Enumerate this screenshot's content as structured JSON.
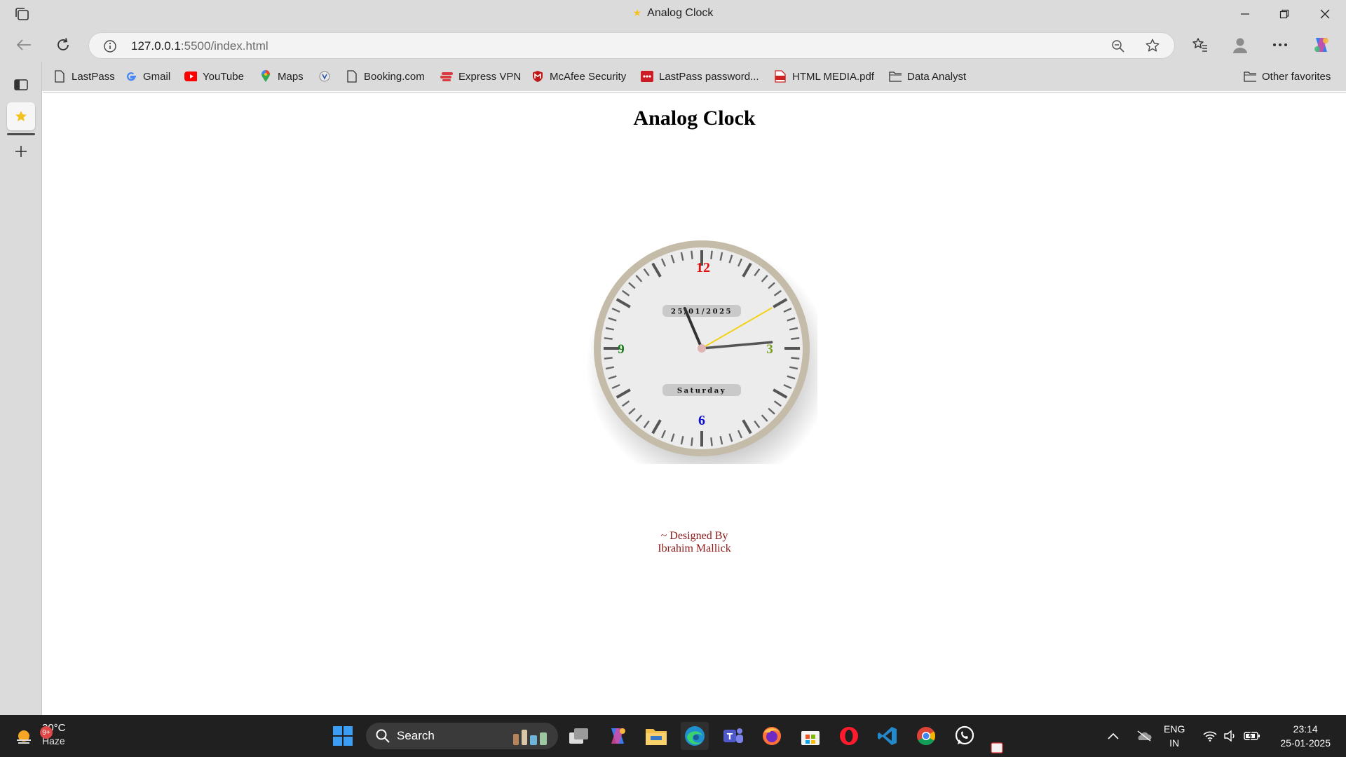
{
  "window": {
    "title": "Analog Clock"
  },
  "address_bar": {
    "url_host": "127.0.0.1",
    "url_path": ":5500/index.html"
  },
  "favorites": {
    "items": [
      {
        "label": "LastPass",
        "icon": "page-icon"
      },
      {
        "label": "Gmail",
        "icon": "google-icon"
      },
      {
        "label": "YouTube",
        "icon": "youtube-icon"
      },
      {
        "label": "Maps",
        "icon": "maps-pin-icon"
      },
      {
        "label": "",
        "icon": "extension-icon"
      },
      {
        "label": "Booking.com",
        "icon": "page-icon"
      },
      {
        "label": "Express VPN",
        "icon": "expressvpn-icon"
      },
      {
        "label": "McAfee Security",
        "icon": "mcafee-icon"
      },
      {
        "label": "LastPass password...",
        "icon": "lastpass-icon"
      },
      {
        "label": "HTML MEDIA.pdf",
        "icon": "pdf-icon"
      },
      {
        "label": "Data Analyst",
        "icon": "folder-icon"
      }
    ],
    "other": "Other favorites"
  },
  "page": {
    "heading": "Analog Clock",
    "credit_line1": "~ Designed By",
    "credit_line2": "Ibrahim Mallick"
  },
  "clock": {
    "date": "25/01/2025",
    "day": "Saturday",
    "numerals": {
      "twelve": "12",
      "three": "3",
      "six": "6",
      "nine": "9"
    },
    "colors": {
      "twelve": "#e01010",
      "three": "#7aa020",
      "six": "#1010d0",
      "nine": "#1a7a1a",
      "bezel": "#c4bba8",
      "face": "#ececec",
      "second_hand": "#f2d21a",
      "hand": "#555555"
    },
    "time": {
      "hour": 23,
      "minute": 14,
      "second": 10
    }
  },
  "taskbar": {
    "weather_temp": "20°C",
    "weather_cond": "Haze",
    "weather_badge": "9+",
    "search_label": "Search",
    "lang_top": "ENG",
    "lang_bottom": "IN",
    "time": "23:14",
    "date": "25-01-2025"
  }
}
